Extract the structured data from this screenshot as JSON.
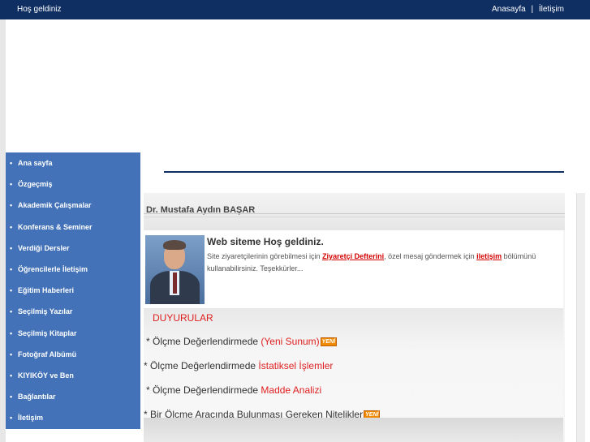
{
  "topbar": {
    "welcome": "Hoş geldiniz",
    "links": [
      "Anasayfa",
      "İletişim"
    ],
    "separator": "|"
  },
  "sidebar": {
    "bullet": "•",
    "items": [
      "Ana sayfa",
      "Özgeçmiş",
      "Akademik Çalışmalar",
      "Konferans & Seminer",
      "Verdiği Dersler",
      "Öğrencilerle İletişim",
      "Eğitim Haberleri",
      "Seçilmiş Yazılar",
      "Seçilmiş Kitaplar",
      "Fotoğraf Albümü",
      "KIYIKÖY ve Ben",
      "Bağlantılar",
      "İletişim"
    ]
  },
  "main": {
    "name": "Dr. Mustafa Aydın BAŞAR",
    "intro_title": "Web siteme Hoş geldiniz.",
    "intro_part1": "Site ziyaretçilerinin görebilmesi için ",
    "intro_link1": "Ziyaretçi Defterini",
    "intro_part2": ", özel mesaj göndermek için ",
    "intro_link2": "iletişim",
    "intro_part3": " bölümünü kullanabilirsiniz. Teşekkürler..."
  },
  "announcements": {
    "title": "DUYURULAR",
    "new_badge": "YENİ",
    "items": [
      {
        "prefix": "* Ölçme Değerlendirmede ",
        "highlight": "(Yeni Sunum)",
        "suffix": ""
      },
      {
        "prefix": "* Ölçme Değerlendirmede ",
        "highlight": "İstatiksel İşlemler",
        "suffix": ""
      },
      {
        "prefix": "* Ölçme Değerlendirmede ",
        "highlight": "Madde Analizi",
        "suffix": ""
      },
      {
        "prefix": "",
        "highlight": "",
        "suffix": "* Bir Ölçme Aracında Bulunması Gereken Nitelikler"
      }
    ]
  },
  "colors": {
    "topbar": "#0f2f63",
    "sidebar": "#4372b8",
    "accent_red": "#e02020"
  }
}
